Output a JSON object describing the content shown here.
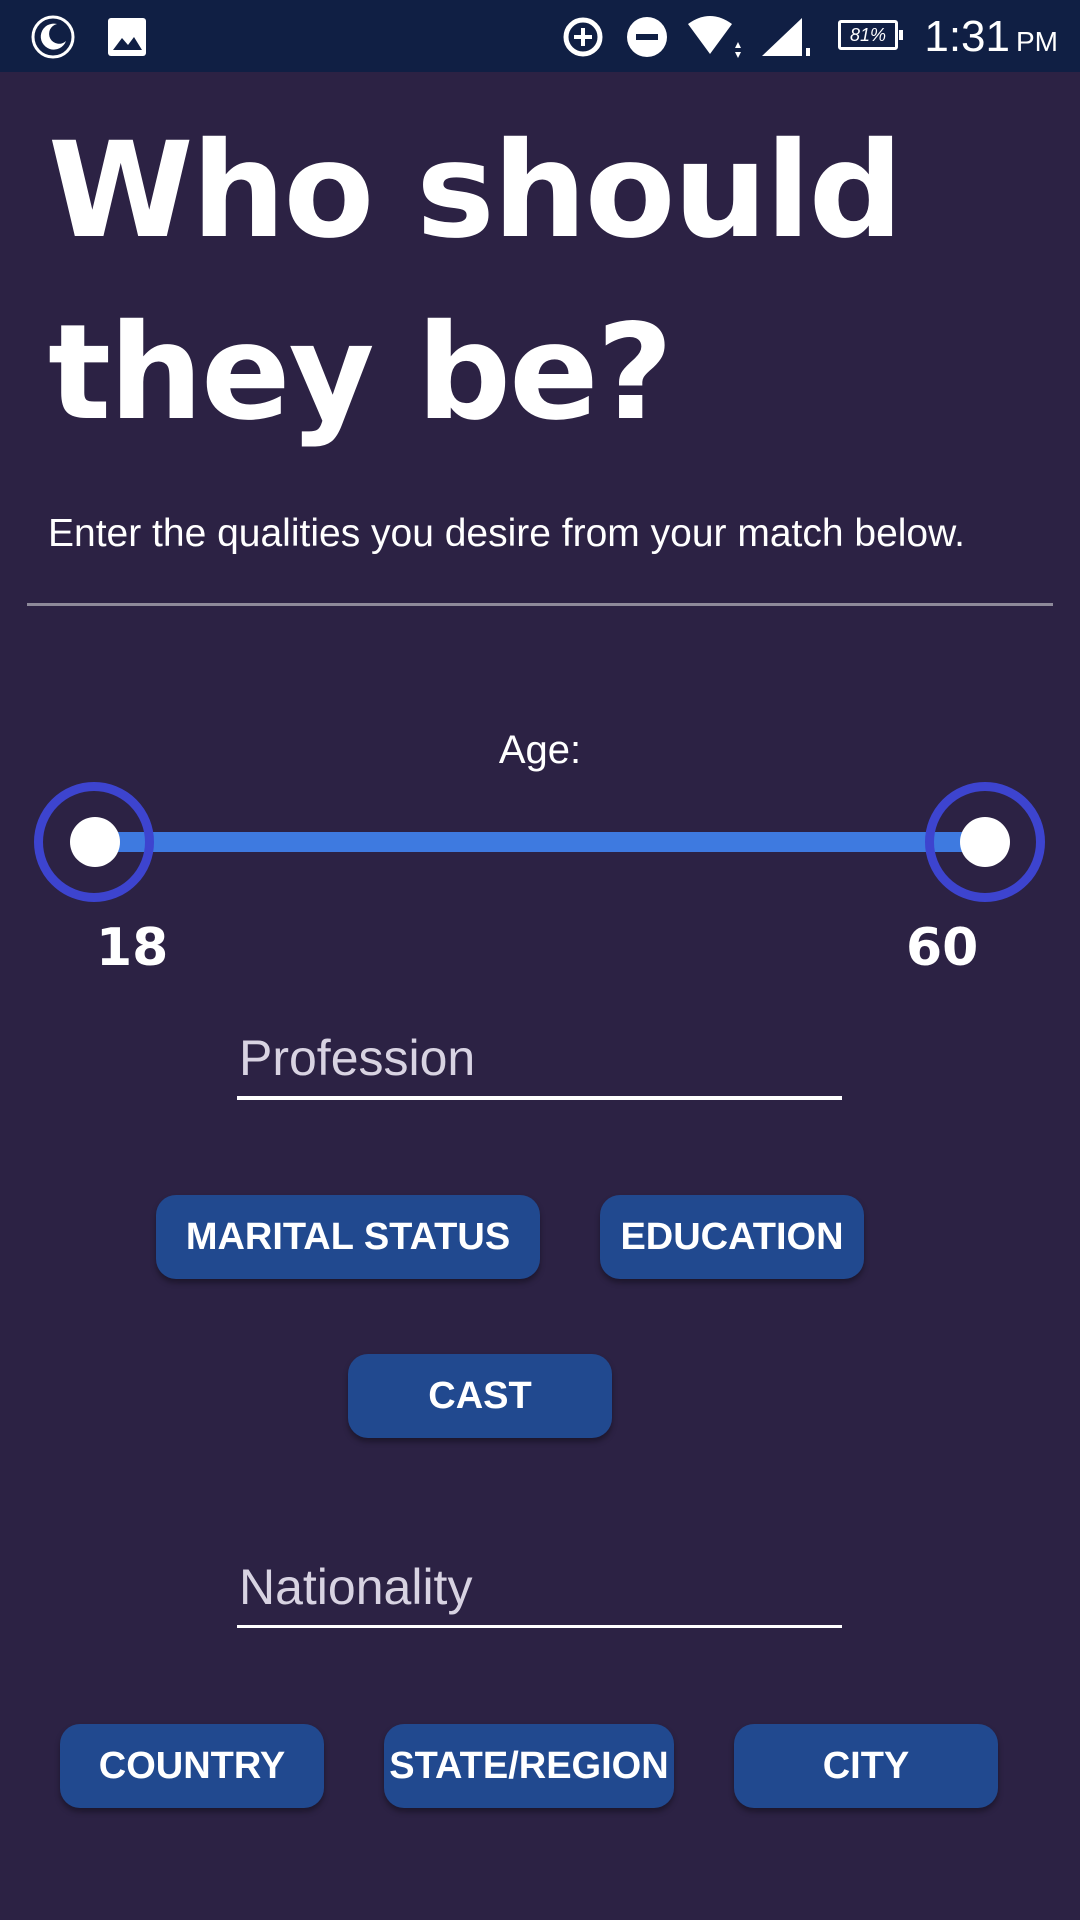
{
  "status_bar": {
    "icons": [
      "moon-icon",
      "image-icon",
      "data-saver-icon",
      "do-not-disturb-icon",
      "wifi-icon",
      "signal-icon"
    ],
    "battery": "81%",
    "time": "1:31",
    "ampm": "PM"
  },
  "page": {
    "title_line1": "Who should",
    "title_line2": "they be?",
    "subtitle": "Enter the qualities you desire from your match below."
  },
  "age": {
    "label": "Age:",
    "min": "18",
    "max": "60",
    "accent": "#3e7ae0",
    "ring_color": "#3d44cf"
  },
  "profession": {
    "placeholder": "Profession",
    "value": ""
  },
  "filters": {
    "marital_status": "MARITAL STATUS",
    "education": "EDUCATION",
    "cast": "CAST"
  },
  "nationality": {
    "placeholder": "Nationality",
    "value": ""
  },
  "location": {
    "country": "COUNTRY",
    "state": "STATE/REGION",
    "city": "CITY"
  },
  "colors": {
    "background": "#2c2244",
    "status_bar": "#101f44",
    "chip": "#21498f"
  }
}
